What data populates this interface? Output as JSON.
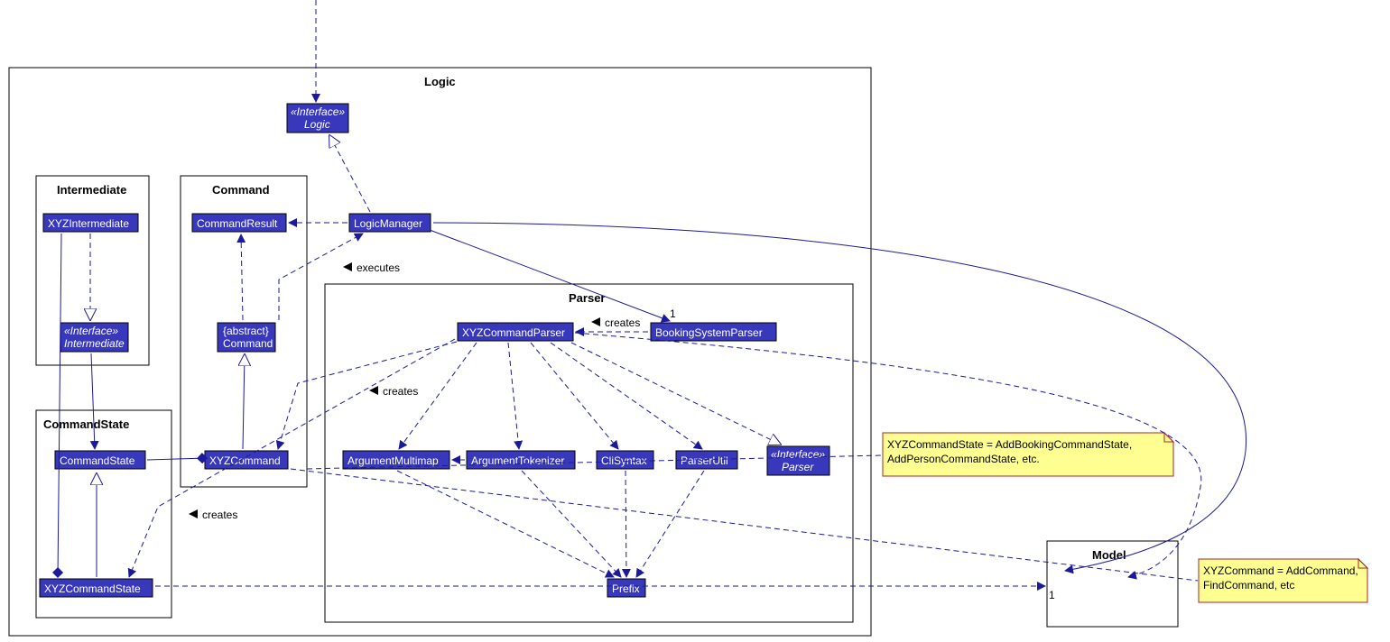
{
  "packages": {
    "logic": "Logic",
    "intermediate": "Intermediate",
    "command": "Command",
    "commandState": "CommandState",
    "parser": "Parser",
    "model": "Model"
  },
  "nodes": {
    "logicIf_stereo": "«Interface»",
    "logicIf_name": "Logic",
    "logicManager": "LogicManager",
    "xyzIntermediate": "XYZIntermediate",
    "intermediateIf_stereo": "«Interface»",
    "intermediateIf_name": "Intermediate",
    "commandResult": "CommandResult",
    "abstractCommand_stereo": "{abstract}",
    "abstractCommand_name": "Command",
    "xyzCommand": "XYZCommand",
    "commandState": "CommandState",
    "xyzCommandState": "XYZCommandState",
    "xyzCommandParser": "XYZCommandParser",
    "bookingSystemParser": "BookingSystemParser",
    "argumentMultimap": "ArgumentMultimap",
    "argumentTokenizer": "ArgumentTokenizer",
    "cliSyntax": "CliSyntax",
    "parserUtil": "ParserUtil",
    "parserIf_stereo": "«Interface»",
    "parserIf_name": "Parser",
    "prefix": "Prefix"
  },
  "labels": {
    "executes": "executes",
    "creates1": "creates",
    "creates2": "creates",
    "creates3": "creates",
    "one_a": "1",
    "one_b": "1"
  },
  "notes": {
    "note1_l1": "XYZCommandState = AddBookingCommandState,",
    "note1_l2": "AddPersonCommandState, etc.",
    "note2_l1": "XYZCommand = AddCommand,",
    "note2_l2": "FindCommand, etc"
  }
}
